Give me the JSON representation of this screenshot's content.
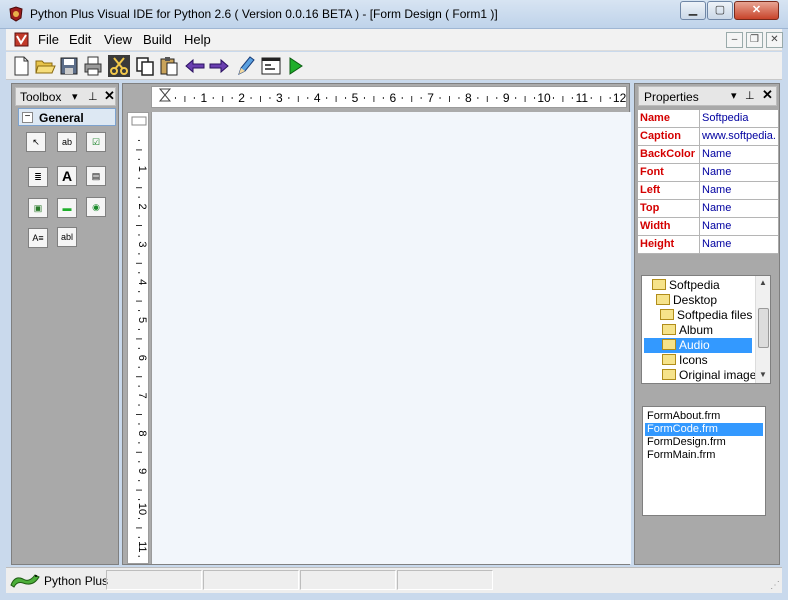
{
  "window": {
    "title": "Python Plus Visual IDE for Python 2.6 (  Version 0.0.16 BETA  ) - [Form Design ( Form1 )]",
    "min_glyph": "▁",
    "max_glyph": "▢",
    "close_glyph": "✕"
  },
  "menu": {
    "items": [
      "File",
      "Edit",
      "View",
      "Build",
      "Help"
    ],
    "mdi_min": "–",
    "mdi_restore": "❐",
    "mdi_close": "✕"
  },
  "toolbar": {
    "buttons": [
      "new-file",
      "open-folder",
      "save",
      "print",
      "cut",
      "copy",
      "paste",
      "back-arrow",
      "forward-arrow",
      "edit-pencil",
      "form-window",
      "run"
    ]
  },
  "toolbox": {
    "title": "Toolbox",
    "dropdown_glyph": "▾",
    "pin_glyph": "⊥",
    "close_glyph": "✕",
    "group": {
      "label": "General",
      "expander": "−"
    },
    "tools": [
      {
        "icon": "pointer",
        "glyph": "↖"
      },
      {
        "icon": "textbox",
        "glyph": "ab"
      },
      {
        "icon": "checkbox",
        "glyph": "☑"
      },
      {
        "icon": "listbox",
        "glyph": "≣"
      },
      {
        "icon": "label",
        "glyph": "A"
      },
      {
        "icon": "combobox",
        "glyph": "▤"
      },
      {
        "icon": "image",
        "glyph": "▣"
      },
      {
        "icon": "progressbar",
        "glyph": "▬"
      },
      {
        "icon": "radiobutton",
        "glyph": "◉"
      },
      {
        "icon": "richtext",
        "glyph": "A≡"
      },
      {
        "icon": "entry",
        "glyph": "abl"
      }
    ]
  },
  "ruler": {
    "top_numbers": [
      "1",
      "2",
      "3",
      "4",
      "5",
      "6",
      "7",
      "8",
      "9",
      "10",
      "11",
      "12"
    ],
    "left_numbers": [
      "1",
      "2",
      "3",
      "4",
      "5",
      "6",
      "7",
      "8",
      "9",
      "10",
      "11"
    ]
  },
  "properties": {
    "title": "Properties",
    "dropdown_glyph": "▾",
    "pin_glyph": "⊥",
    "close_glyph": "✕",
    "rows": [
      {
        "name": "Name",
        "value": "Softpedia"
      },
      {
        "name": "Caption",
        "value": "www.softpedia."
      },
      {
        "name": "BackColor",
        "value": "Name"
      },
      {
        "name": "Font",
        "value": "Name"
      },
      {
        "name": "Left",
        "value": "Name"
      },
      {
        "name": "Top",
        "value": "Name"
      },
      {
        "name": "Width",
        "value": "Name"
      },
      {
        "name": "Height",
        "value": "Name"
      }
    ]
  },
  "folder_tree": {
    "items": [
      {
        "label": "Softpedia",
        "level": 1,
        "selected": false
      },
      {
        "label": "Desktop",
        "level": 1,
        "selected": false
      },
      {
        "label": "Softpedia files",
        "level": 2,
        "selected": false
      },
      {
        "label": "Album",
        "level": 2,
        "selected": false
      },
      {
        "label": "Audio",
        "level": 2,
        "selected": true
      },
      {
        "label": "Icons",
        "level": 2,
        "selected": false
      },
      {
        "label": "Original images",
        "level": 2,
        "selected": false
      }
    ],
    "scroll_up": "▲",
    "scroll_down": "▼"
  },
  "file_list": {
    "items": [
      "FormAbout.frm",
      "FormCode.frm",
      "FormDesign.frm",
      "FormMain.frm"
    ],
    "selected": "FormCode.frm"
  },
  "statusbar": {
    "text": "Python Plus",
    "grip": "⋰"
  },
  "colors": {
    "prop_name": "#d40000",
    "prop_value": "#0000a0",
    "selection": "#3399ff"
  }
}
